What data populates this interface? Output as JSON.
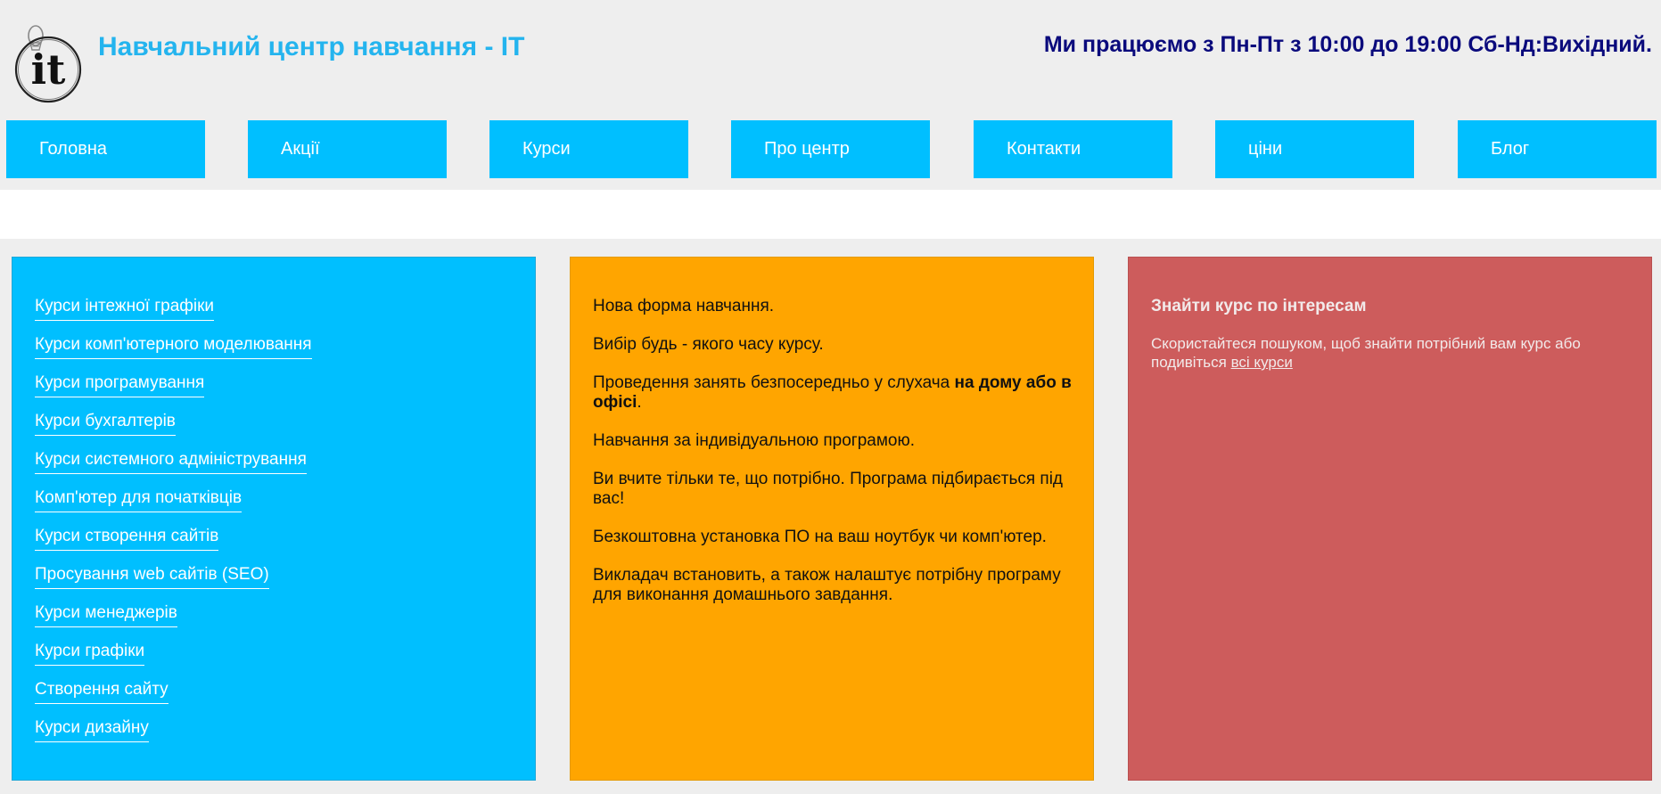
{
  "header": {
    "logo_text": "it",
    "title": "Навчальний центр навчання - IT",
    "hours": "Ми працюємо з Пн-Пт з 10:00 до 19:00 Сб-Нд:Вихідний."
  },
  "nav": {
    "items": [
      {
        "label": "Головна"
      },
      {
        "label": "Акції"
      },
      {
        "label": "Курси"
      },
      {
        "label": "Про центр"
      },
      {
        "label": "Контакти"
      },
      {
        "label": "ціни"
      },
      {
        "label": "Блог"
      }
    ]
  },
  "courses": [
    "Курси інтежної графіки",
    "Курси комп'ютерного моделювання",
    "Курси програмування",
    "Курси бухгалтерів",
    "Курси системного адміністрування",
    "Комп'ютер для початківців",
    "Курси створення сайтів",
    "Просування web сайтів (SEO)",
    "Курси менеджерів",
    "Курси графіки",
    "Створення сайту",
    "Курси дизайну"
  ],
  "features": {
    "p1": "Нова форма навчання.",
    "p2": "Вибір будь - якого часу курсу.",
    "p3_prefix": "Проведення занять безпосередньо у слухача ",
    "p3_bold": "на дому або в офісі",
    "p3_suffix": ".",
    "p4": "Навчання за індивідуальною програмою.",
    "p5": "Ви вчите тільки те, що потрібно. Програма підбирається під вас!",
    "p6": "Безкоштовна установка ПО на ваш ноутбук чи комп'ютер.",
    "p7": "Викладач встановить, а також налаштує потрібну програму для виконання домашнього завдання."
  },
  "search_box": {
    "title": "Знайти курс по інтересам",
    "desc": "Скористайтеся пошуком, щоб знайти потрібний вам курс або подивіться ",
    "link": "всі курси"
  },
  "colors": {
    "title": "#24b4ee",
    "hours": "#0a0a7c",
    "nav_bg": "#00bfff",
    "left_col": "#00bfff",
    "mid_col": "#ffa500",
    "right_col": "#cd5c5c"
  },
  "icons": {
    "logo": "lightbulb-it-logo-icon"
  }
}
